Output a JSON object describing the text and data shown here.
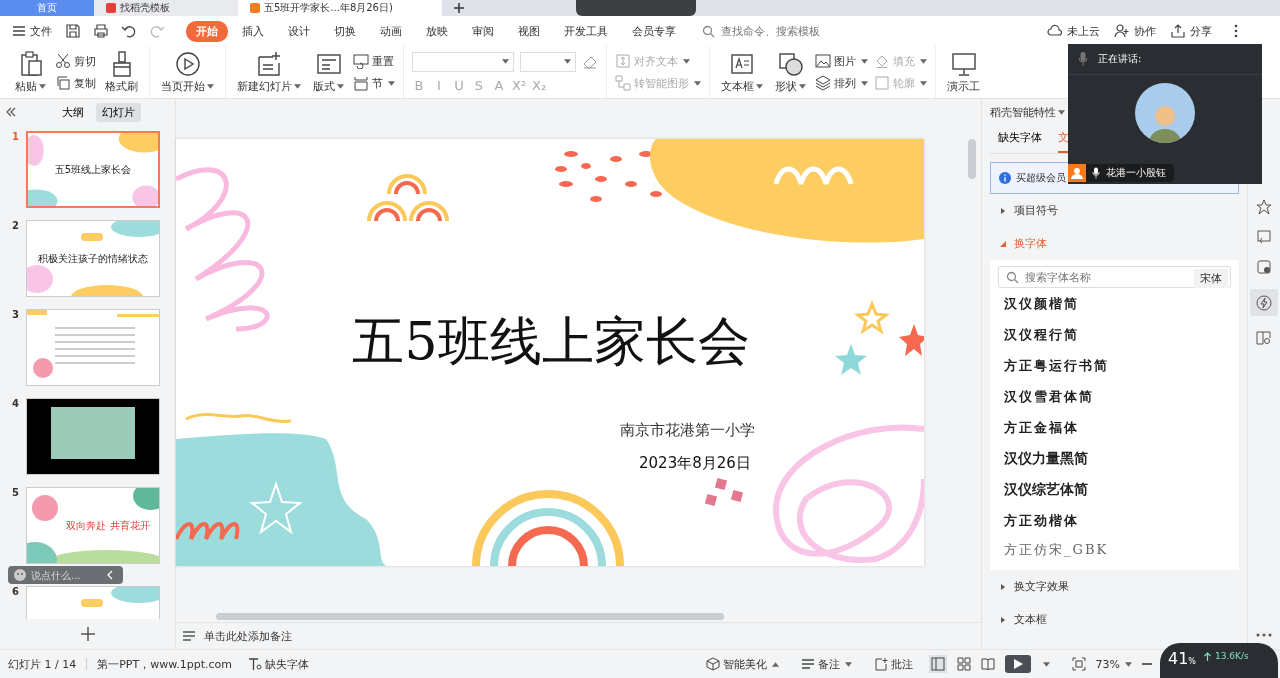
{
  "app_tabs": [
    {
      "label": "首页",
      "kind": "home",
      "selected": false
    },
    {
      "label": "找稻壳模板",
      "kind": "template",
      "selected": false
    },
    {
      "label": "五5班开学家长...年8月26日)",
      "kind": "doc",
      "selected": true
    }
  ],
  "menu": {
    "file": "文件",
    "ribbon_tabs": [
      {
        "label": "开始",
        "selected": true
      },
      {
        "label": "插入",
        "selected": false
      },
      {
        "label": "设计",
        "selected": false
      },
      {
        "label": "切换",
        "selected": false
      },
      {
        "label": "动画",
        "selected": false
      },
      {
        "label": "放映",
        "selected": false
      },
      {
        "label": "审阅",
        "selected": false
      },
      {
        "label": "视图",
        "selected": false
      },
      {
        "label": "开发工具",
        "selected": false
      },
      {
        "label": "会员专享",
        "selected": false
      }
    ],
    "search": {
      "placeholder": "查找命令、搜索模板"
    },
    "actions": [
      {
        "label": "未上云",
        "kind": "cloud"
      },
      {
        "label": "协作",
        "kind": "collab"
      },
      {
        "label": "分享",
        "kind": "share"
      }
    ]
  },
  "ribbon": {
    "paste": "粘贴",
    "cut": "剪切",
    "copy": "复制",
    "format_painter": "格式刷",
    "play_from_current": "当页开始",
    "new_slide": "新建幻灯片",
    "layout": "版式",
    "reset": "重置",
    "section": "节",
    "format_buttons": [
      "B",
      "I",
      "U",
      "S",
      "A",
      "X²",
      "X₂"
    ],
    "align_text": "对齐文本",
    "smart_art": "转智能图形",
    "text_box": "文本框",
    "shape": "形状",
    "picture": "图片",
    "arrange": "排列",
    "fill": "填充",
    "outline": "轮廓",
    "presentation_tools": "演示工"
  },
  "video_call": {
    "speaking_label": "正在讲话:",
    "speaker_name": "花港一小殷钰"
  },
  "slide_panel": {
    "tabs": [
      {
        "label": "大纲",
        "selected": false
      },
      {
        "label": "幻灯片",
        "selected": true
      }
    ],
    "slides": [
      {
        "number": "1",
        "selected": true,
        "kind": "title",
        "title": "五5班线上家长会"
      },
      {
        "number": "2",
        "selected": false,
        "kind": "section",
        "title": "积极关注孩子的情绪状态"
      },
      {
        "number": "3",
        "selected": false,
        "kind": "text"
      },
      {
        "number": "4",
        "selected": false,
        "kind": "video"
      },
      {
        "number": "5",
        "selected": false,
        "kind": "cover",
        "title": "双向奔赴  共育花开"
      },
      {
        "number": "6",
        "selected": false,
        "kind": "section"
      }
    ],
    "chat_placeholder": "说点什么..."
  },
  "slide": {
    "title": "五5班线上家长会",
    "school": "南京市花港第一小学",
    "date": "2023年8月26日"
  },
  "notes": {
    "placeholder": "单击此处添加备注"
  },
  "right_panel": {
    "header": "稻壳智能特性",
    "tabs": [
      {
        "label": "缺失字体",
        "selected": false
      },
      {
        "label": "文",
        "selected": true
      }
    ],
    "banner": "买超级会员",
    "sections": [
      {
        "label": "项目符号",
        "kind": "bullets",
        "expanded": false
      },
      {
        "label": "换字体",
        "kind": "fonts",
        "expanded": true
      },
      {
        "label": "换文字效果",
        "kind": "effects",
        "expanded": false
      },
      {
        "label": "文本框",
        "kind": "textbox",
        "expanded": false
      }
    ],
    "font_search": {
      "placeholder": "搜索字体名称",
      "current": "宋体"
    },
    "fonts": [
      "汉仪颜楷简",
      "汉仪程行简",
      "方正粤运行书简",
      "汉仪雪君体简",
      "方正金福体",
      "汉仪力量黑简",
      "汉仪综艺体简",
      "方正劲楷体",
      "方正仿宋_GBK"
    ]
  },
  "status_bar": {
    "slide_counter": "幻灯片 1 / 14",
    "template": "第一PPT，www.1ppt.com",
    "missing_fonts": "缺失字体",
    "beautify": "智能美化",
    "notes": "备注",
    "comments": "批注",
    "zoom": "73%"
  },
  "network_widget": {
    "percent": "41",
    "unit": "%",
    "upload": "13.6K/s"
  }
}
